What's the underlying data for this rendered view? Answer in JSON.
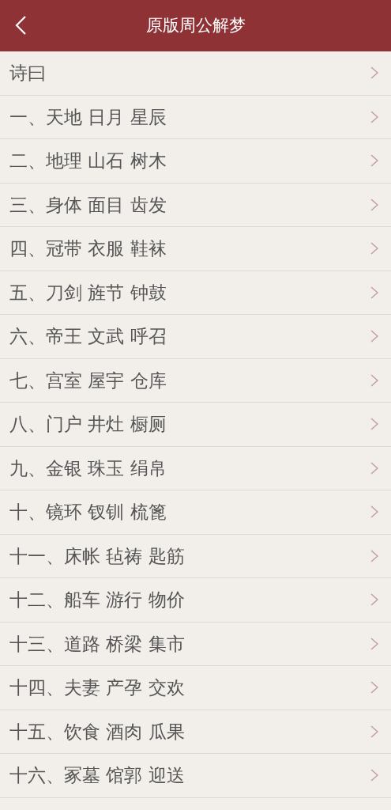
{
  "header": {
    "title": "原版周公解梦"
  },
  "items": [
    {
      "label": "诗曰"
    },
    {
      "label": "一、天地 日月 星辰"
    },
    {
      "label": "二、地理 山石 树木"
    },
    {
      "label": "三、身体 面目 齿发"
    },
    {
      "label": "四、冠带 衣服 鞋袜"
    },
    {
      "label": "五、刀剑 旌节 钟鼓"
    },
    {
      "label": "六、帝王 文武 呼召"
    },
    {
      "label": "七、宫室 屋宇 仓库"
    },
    {
      "label": "八、门户 井灶 橱厕"
    },
    {
      "label": "九、金银 珠玉 绢帛"
    },
    {
      "label": "十、镜环 钗钏 梳篦"
    },
    {
      "label": "十一、床帐 毡祷 匙筋"
    },
    {
      "label": "十二、船车 游行 物价"
    },
    {
      "label": "十三、道路 桥梁 集市"
    },
    {
      "label": "十四、夫妻 产孕 交欢"
    },
    {
      "label": "十五、饮食 酒肉 瓜果"
    },
    {
      "label": "十六、冢墓 馆郭 迎送"
    }
  ]
}
